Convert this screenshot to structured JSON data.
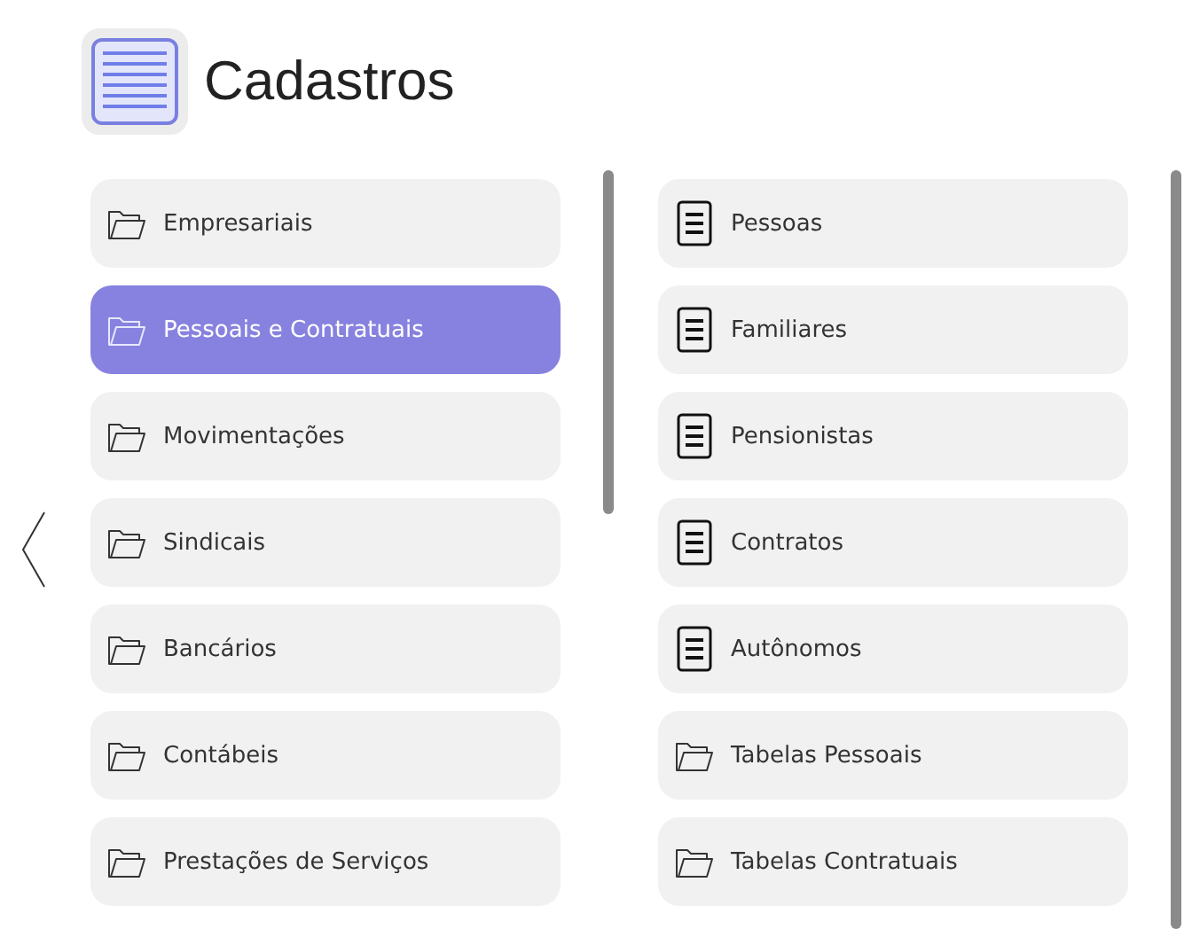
{
  "title": "Cadastros",
  "categories": [
    {
      "label": "Empresariais",
      "selected": false
    },
    {
      "label": "Pessoais e Contratuais",
      "selected": true
    },
    {
      "label": "Movimentações",
      "selected": false
    },
    {
      "label": "Sindicais",
      "selected": false
    },
    {
      "label": "Bancários",
      "selected": false
    },
    {
      "label": "Contábeis",
      "selected": false
    },
    {
      "label": "Prestações de Serviços",
      "selected": false
    }
  ],
  "entries": [
    {
      "label": "Pessoas",
      "kind": "form"
    },
    {
      "label": "Familiares",
      "kind": "form"
    },
    {
      "label": "Pensionistas",
      "kind": "form"
    },
    {
      "label": "Contratos",
      "kind": "form"
    },
    {
      "label": "Autônomos",
      "kind": "form"
    },
    {
      "label": "Tabelas Pessoais",
      "kind": "folder"
    },
    {
      "label": "Tabelas Contratuais",
      "kind": "folder"
    }
  ]
}
